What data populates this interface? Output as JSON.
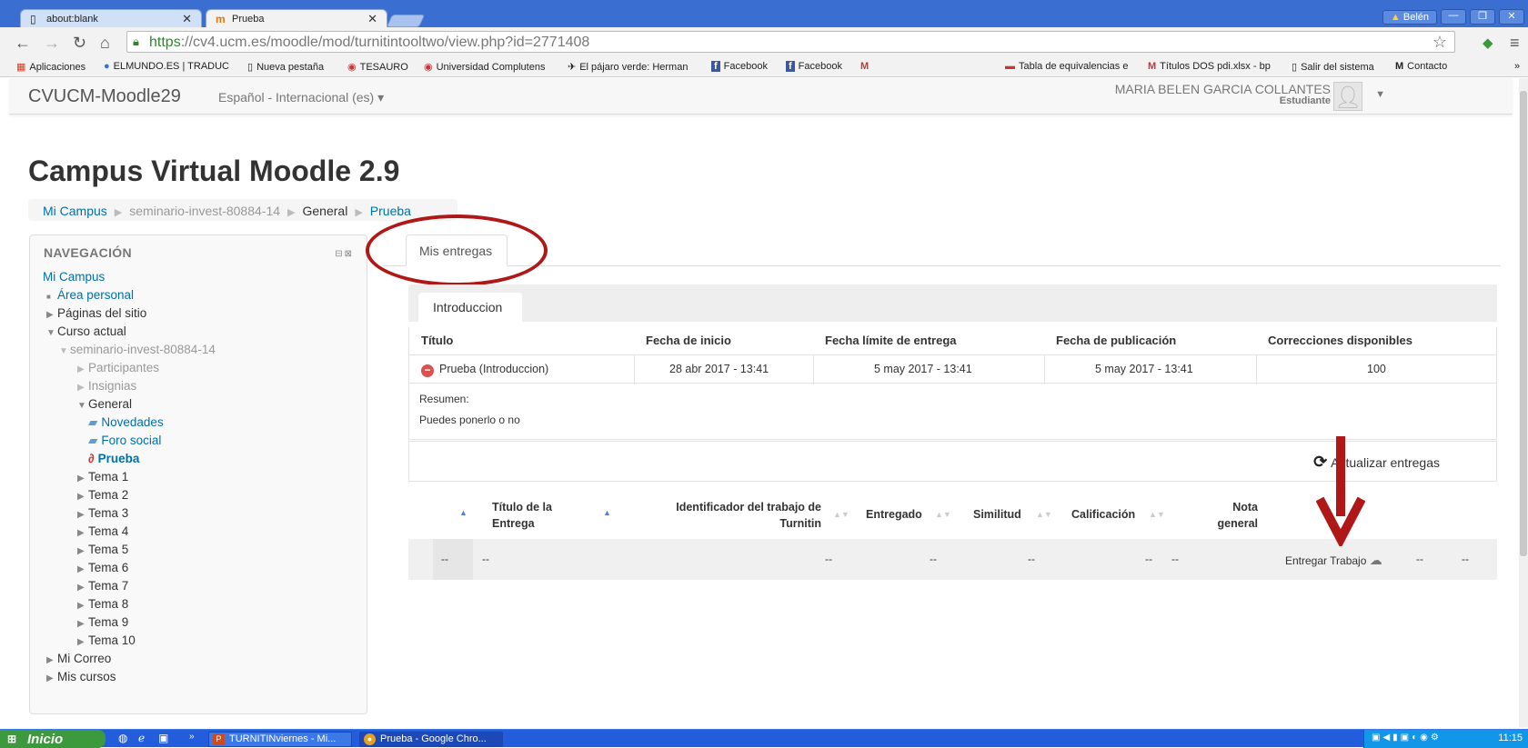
{
  "browser": {
    "tabs": [
      {
        "title": "about:blank",
        "icon": "page-icon"
      },
      {
        "title": "Prueba",
        "icon": "moodle-icon"
      }
    ],
    "user_badge": "Belén",
    "url_scheme": "https",
    "url_rest": "://cv4.ucm.es/moodle/mod/turnitintooltwo/view.php?id=2771408",
    "bookmarks": [
      "Aplicaciones",
      "ELMUNDO.ES | TRADUC",
      "Nueva pestaña",
      "TESAURO",
      "Universidad Complutens",
      "El pájaro verde: Herman",
      "Facebook",
      "Facebook",
      "Tabla de equivalencias e",
      "Títulos DOS pdi.xlsx - bp",
      "Salir del sistema",
      "Contacto"
    ]
  },
  "moodle": {
    "brand": "CVUCM-Moodle29",
    "language": "Español - Internacional (es) ▾",
    "user_name": "MARIA BELEN GARCIA COLLANTES",
    "user_role": "Estudiante"
  },
  "page_title": "Campus Virtual Moodle 2.9",
  "breadcrumb": [
    "Mi Campus",
    "seminario-invest-80884-14",
    "General",
    "Prueba"
  ],
  "navigation": {
    "title": "NAVEGACIÓN",
    "items": [
      "Mi Campus",
      "Área personal",
      "Páginas del sitio",
      "Curso actual",
      "seminario-invest-80884-14",
      "Participantes",
      "Insignias",
      "General",
      "Novedades",
      "Foro social",
      "Prueba",
      "Tema 1",
      "Tema 2",
      "Tema 3",
      "Tema 4",
      "Tema 5",
      "Tema 6",
      "Tema 7",
      "Tema 8",
      "Tema 9",
      "Tema 10",
      "Mi Correo",
      "Mis cursos"
    ]
  },
  "tabs": {
    "mis_entregas": "Mis entregas",
    "part": "Introduccion"
  },
  "info_table": {
    "headers": [
      "Título",
      "Fecha de inicio",
      "Fecha límite de entrega",
      "Fecha de publicación",
      "Correcciones disponibles"
    ],
    "row": [
      "Prueba (Introduccion)",
      "28 abr 2017 - 13:41",
      "5 may 2017 - 13:41",
      "5 may 2017 - 13:41",
      "100"
    ],
    "summary_label": "Resumen:",
    "summary_text": "Puedes ponerlo o no"
  },
  "refresh_label": "Actualizar entregas",
  "submissions": {
    "headers": [
      "Título de la Entrega",
      "Identificador del trabajo de Turnitin",
      "Entregado",
      "Similitud",
      "Calificación",
      "Nota general"
    ],
    "row": {
      "c0": "--",
      "title": "--",
      "id": "--",
      "submitted": "--",
      "similarity": "--",
      "grade_a": "--",
      "grade_b": "--",
      "submit_label": "Entregar Trabajo",
      "tail_a": "--",
      "tail_b": "--"
    }
  },
  "taskbar": {
    "start": "Inicio",
    "tasks": [
      "TURNITINviernes - Mi...",
      "Prueba - Google Chro..."
    ],
    "clock": "11:15"
  },
  "colors": {
    "link": "#0070a8",
    "annotation_red": "#b01818",
    "taskbar": "#245ddb"
  }
}
